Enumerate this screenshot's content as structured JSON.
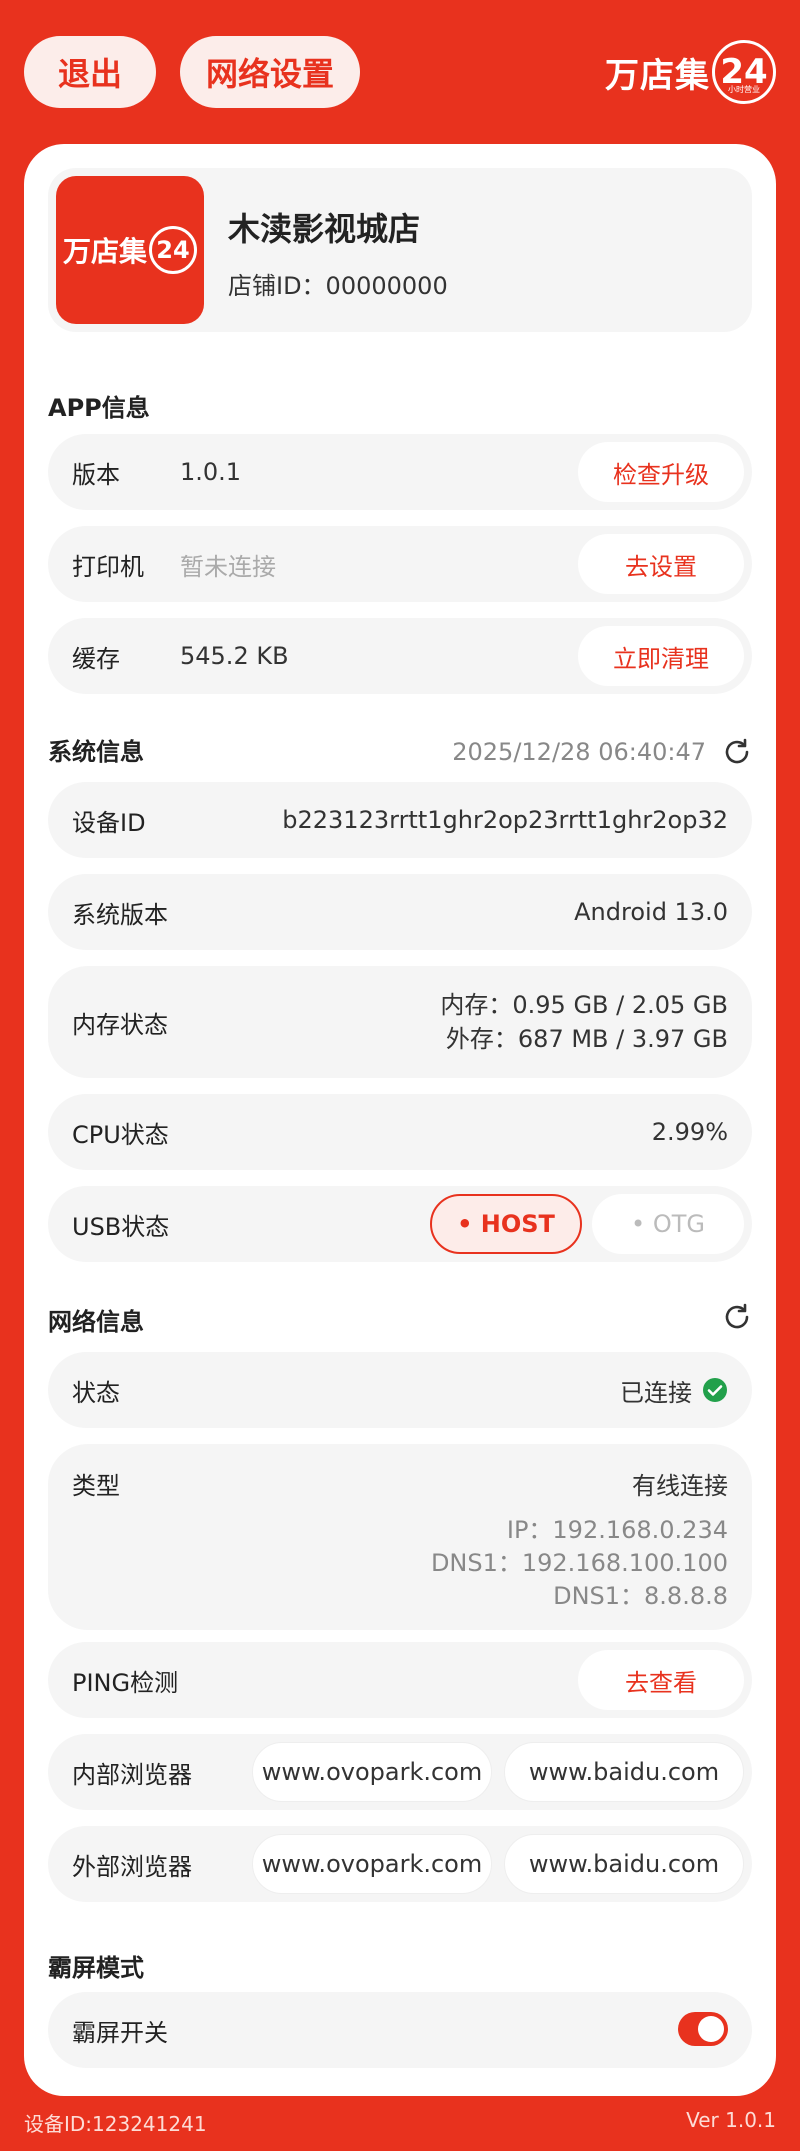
{
  "topbar": {
    "logout_label": "退出",
    "network_settings_label": "网络设置",
    "brand_text": "万店集",
    "brand_number": "24",
    "brand_sub": "小时营业"
  },
  "store": {
    "logo_text": "万店集",
    "logo_number": "24",
    "name": "木渎影视城店",
    "id_text": "店铺ID：00000000"
  },
  "app_info": {
    "title": "APP信息",
    "version": {
      "label": "版本",
      "value": "1.0.1",
      "action": "检查升级"
    },
    "printer": {
      "label": "打印机",
      "value": "暂未连接",
      "action": "去设置"
    },
    "cache": {
      "label": "缓存",
      "value": "545.2 KB",
      "action": "立即清理"
    }
  },
  "system_info": {
    "title": "系统信息",
    "timestamp": "2025/12/28 06:40:47",
    "device_id": {
      "label": "设备ID",
      "value": "b223123rrtt1ghr2op23rrtt1ghr2op32"
    },
    "os_version": {
      "label": "系统版本",
      "value": "Android 13.0"
    },
    "memory": {
      "label": "内存状态",
      "ram": "内存：0.95 GB / 2.05 GB",
      "storage": "外存：687 MB / 3.97 GB"
    },
    "cpu": {
      "label": "CPU状态",
      "value": "2.99%"
    },
    "usb": {
      "label": "USB状态",
      "host": "• HOST",
      "otg": "• OTG",
      "selected": "HOST"
    }
  },
  "network_info": {
    "title": "网络信息",
    "status": {
      "label": "状态",
      "value": "已连接"
    },
    "type": {
      "label": "类型",
      "value": "有线连接",
      "ip": "IP：192.168.0.234",
      "dns1": "DNS1：192.168.100.100",
      "dns2": "DNS1：8.8.8.8"
    },
    "ping": {
      "label": "PING检测",
      "action": "去查看"
    },
    "internal_browser": {
      "label": "内部浏览器",
      "url1": "www.ovopark.com",
      "url2": "www.baidu.com"
    },
    "external_browser": {
      "label": "外部浏览器",
      "url1": "www.ovopark.com",
      "url2": "www.baidu.com"
    }
  },
  "kiosk": {
    "title": "霸屏模式",
    "switch_label": "霸屏开关",
    "enabled": true
  },
  "footer": {
    "device_id": "设备ID:123241241",
    "version": "Ver 1.0.1"
  },
  "colors": {
    "primary": "#E8321E",
    "success": "#22A04B",
    "row_bg": "#F5F5F5"
  }
}
